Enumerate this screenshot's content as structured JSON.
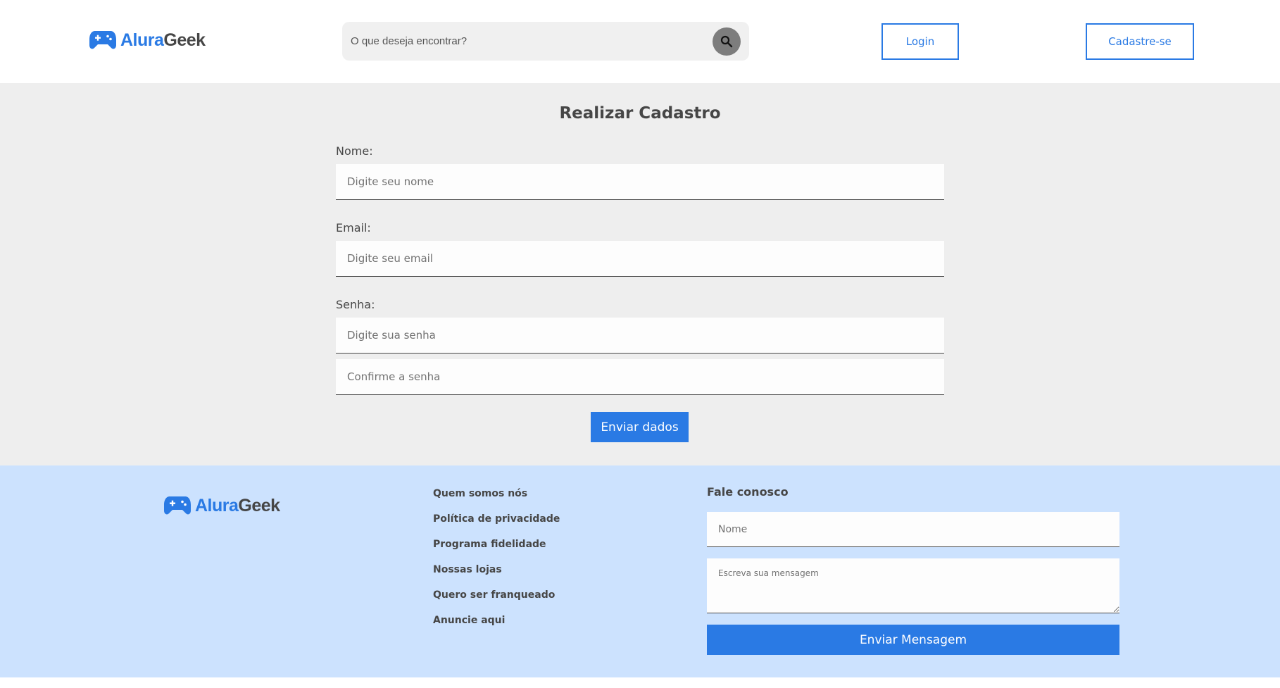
{
  "brand": {
    "logo_part1": "Alura",
    "logo_part2": "Geek",
    "logo_icon": "gamepad-icon",
    "primary_color": "#2a7ae4",
    "text_color": "#464646"
  },
  "header": {
    "search_placeholder": "O que deseja encontrar?",
    "search_icon": "search-icon",
    "login_label": "Login",
    "signup_label": "Cadastre-se"
  },
  "form": {
    "title": "Realizar Cadastro",
    "name_label": "Nome:",
    "name_placeholder": "Digite seu nome",
    "email_label": "Email:",
    "email_placeholder": "Digite seu email",
    "password_label": "Senha:",
    "password_placeholder": "Digite sua senha",
    "confirm_placeholder": "Confirme a senha",
    "submit_label": "Enviar dados"
  },
  "footer": {
    "links": [
      "Quem somos nós",
      "Política de privacidade",
      "Programa fidelidade",
      "Nossas lojas",
      "Quero ser franqueado",
      "Anuncie aqui"
    ],
    "contact_title": "Fale conosco",
    "contact_name_placeholder": "Nome",
    "contact_message_placeholder": "Escreva sua mensagem",
    "contact_submit_label": "Enviar Mensagem"
  }
}
